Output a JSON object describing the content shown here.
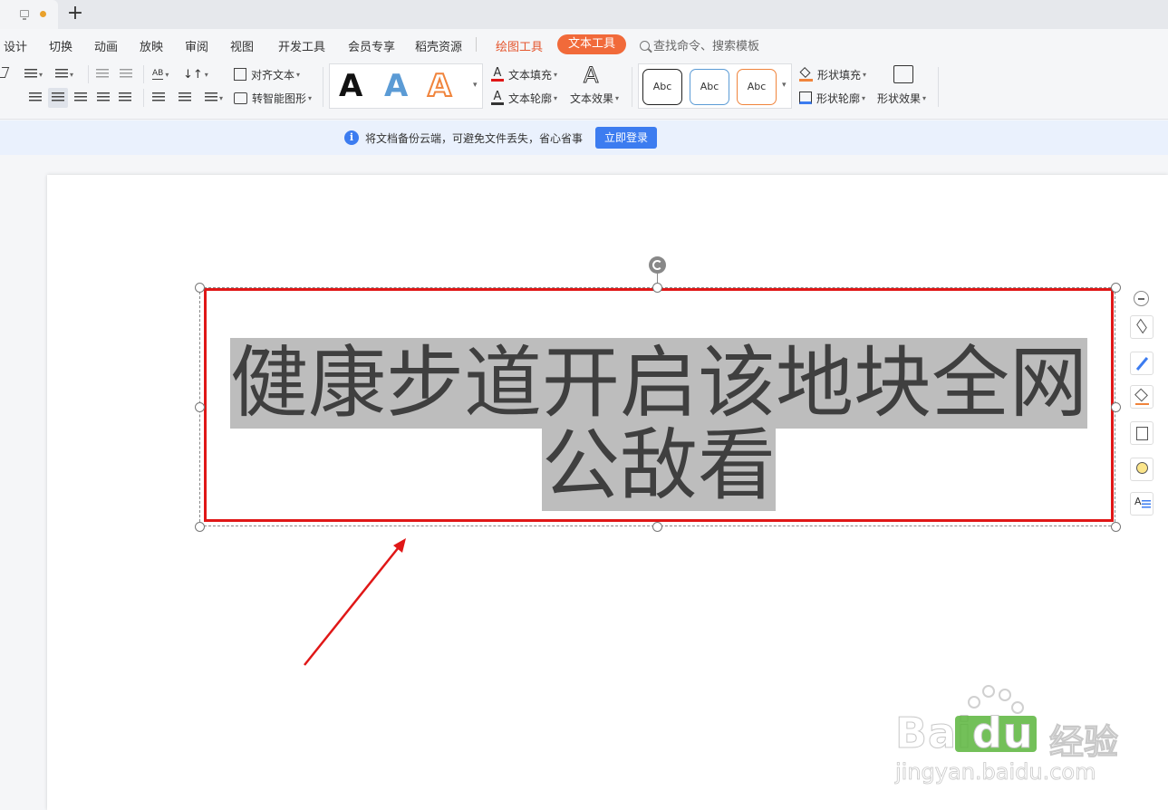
{
  "menu": {
    "items": [
      "设计",
      "切换",
      "动画",
      "放映",
      "审阅",
      "视图",
      "开发工具",
      "会员专享",
      "稻壳资源"
    ],
    "drawing_tools": "绘图工具",
    "text_tools": "文本工具",
    "search_placeholder": "查找命令、搜索模板"
  },
  "ribbon": {
    "align_text": "对齐文本",
    "smart_shape": "转智能图形",
    "text_fill": "文本填充",
    "text_outline": "文本轮廓",
    "text_effect": "文本效果",
    "shape_fill": "形状填充",
    "shape_outline": "形状轮廓",
    "shape_effect": "形状效果",
    "wordart_sample": "A",
    "style_sample": "Abc",
    "spacing_label": "AB"
  },
  "notice": {
    "message": "将文档备份云端，可避免文件丢失，省心省事",
    "login": "立即登录",
    "info_glyph": "i"
  },
  "slide": {
    "line1": "健康步道开启该地块全网",
    "line2": "公敌看"
  },
  "watermark": {
    "brand": "Bai",
    "brand_du": "du",
    "cn": "经验",
    "url": "jingyan.baidu.com"
  },
  "colors": {
    "accent": "#f16a3a",
    "annotation": "#e01717",
    "info_blue": "#3c7cf0"
  }
}
